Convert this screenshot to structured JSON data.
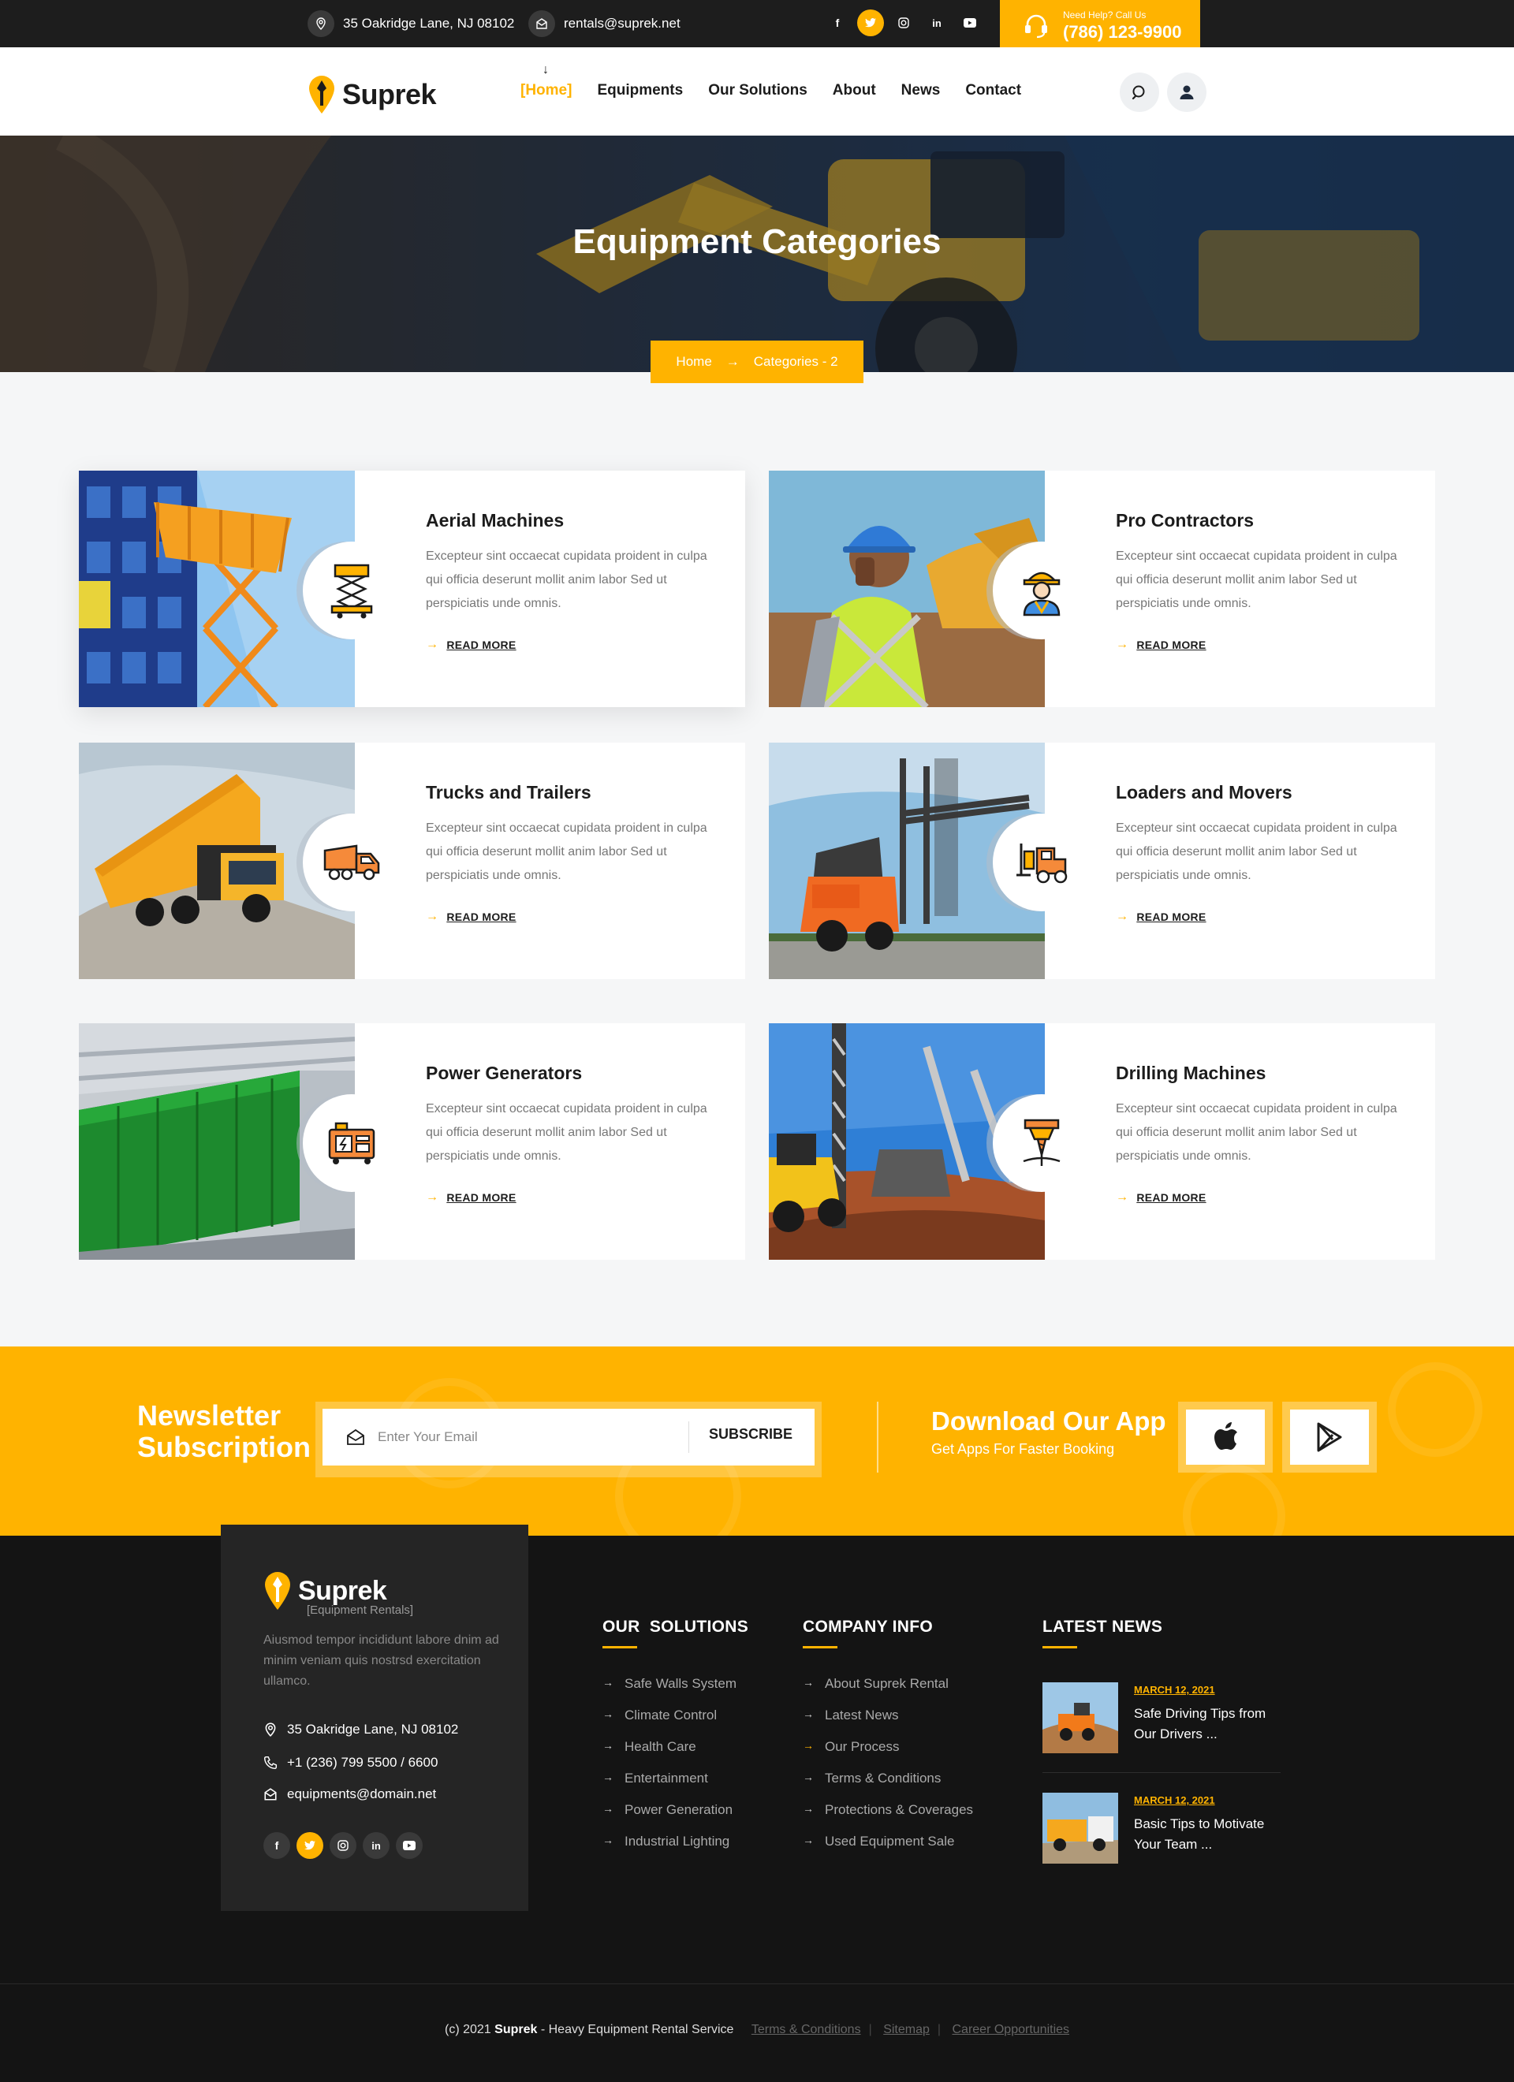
{
  "topbar": {
    "address": "35 Oakridge Lane, NJ 08102",
    "email": "rentals@suprek.net",
    "socials": [
      "f",
      "t",
      "ig",
      "in",
      "yt"
    ],
    "help_label": "Need Help? Call Us",
    "help_phone": "(786) 123-9900"
  },
  "header": {
    "logo": "Suprek",
    "nav": [
      "[Home]",
      "Equipments",
      "Our Solutions",
      "About",
      "News",
      "Contact"
    ]
  },
  "hero": {
    "title": "Equipment Categories",
    "breadcrumb_home": "Home",
    "breadcrumb_current": "Categories - 2"
  },
  "colors": {
    "accent": "#ffb300",
    "dark": "#1d1d1d",
    "footer": "#141414"
  },
  "categories": [
    {
      "title": "Aerial Machines",
      "icon": "scissor-lift-icon",
      "desc": "Excepteur sint occaecat cupidata proident in culpa qui officia deserunt mollit anim labor Sed ut perspiciatis unde omnis.",
      "more": "READ MORE"
    },
    {
      "title": "Pro Contractors",
      "icon": "worker-icon",
      "desc": "Excepteur sint occaecat cupidata proident in culpa qui officia deserunt mollit anim labor Sed ut perspiciatis unde omnis.",
      "more": "READ MORE"
    },
    {
      "title": "Trucks and Trailers",
      "icon": "truck-icon",
      "desc": "Excepteur sint occaecat cupidata proident in culpa qui officia deserunt mollit anim labor Sed ut perspiciatis unde omnis.",
      "more": "READ MORE"
    },
    {
      "title": "Loaders and Movers",
      "icon": "forklift-icon",
      "desc": "Excepteur sint occaecat cupidata proident in culpa qui officia deserunt mollit anim labor Sed ut perspiciatis unde omnis.",
      "more": "READ MORE"
    },
    {
      "title": "Power Generators",
      "icon": "generator-icon",
      "desc": "Excepteur sint occaecat cupidata proident in culpa qui officia deserunt mollit anim labor Sed ut perspiciatis unde omnis.",
      "more": "READ MORE"
    },
    {
      "title": "Drilling Machines",
      "icon": "drill-icon",
      "desc": "Excepteur sint occaecat cupidata proident in culpa qui officia deserunt mollit anim labor Sed ut perspiciatis unde omnis.",
      "more": "READ MORE"
    }
  ],
  "newsletter": {
    "title_line1": "Newsletter",
    "title_line2": "Subscription",
    "placeholder": "Enter Your Email",
    "button": "SUBSCRIBE",
    "app_title": "Download Our App",
    "app_sub": "Get Apps For Faster Booking"
  },
  "footer": {
    "logo": "Suprek",
    "logo_sub": "[Equipment Rentals]",
    "about": "Aiusmod tempor incididunt labore dnim ad minim veniam quis nostrsd exercitation ullamco.",
    "address": "35 Oakridge Lane, NJ 08102",
    "phone": "+1 (236) 799 5500 / 6600",
    "email": "equipments@domain.net",
    "solutions_title": "OUR  SOLUTIONS",
    "solutions": [
      "Safe Walls System",
      "Climate Control",
      "Health Care",
      "Entertainment",
      "Power Generation",
      "Industrial Lighting"
    ],
    "company_title": "COMPANY INFO",
    "company": [
      "About Suprek Rental",
      "Latest News",
      "Our Process",
      "Terms & Conditions",
      "Protections & Coverages",
      "Used Equipment Sale"
    ],
    "news_title": "LATEST NEWS",
    "posts": [
      {
        "date": "MARCH 12, 2021",
        "title": "Safe Driving Tips from Our Drivers ..."
      },
      {
        "date": "MARCH 12, 2021",
        "title": "Basic Tips to Motivate Your Team ..."
      }
    ],
    "copy_prefix": "(c) 2021",
    "copy_brand": "Suprek",
    "copy_suffix": "- Heavy Equipment Rental Service",
    "links": [
      "Terms & Conditions",
      "Sitemap",
      "Career Opportunities"
    ]
  }
}
